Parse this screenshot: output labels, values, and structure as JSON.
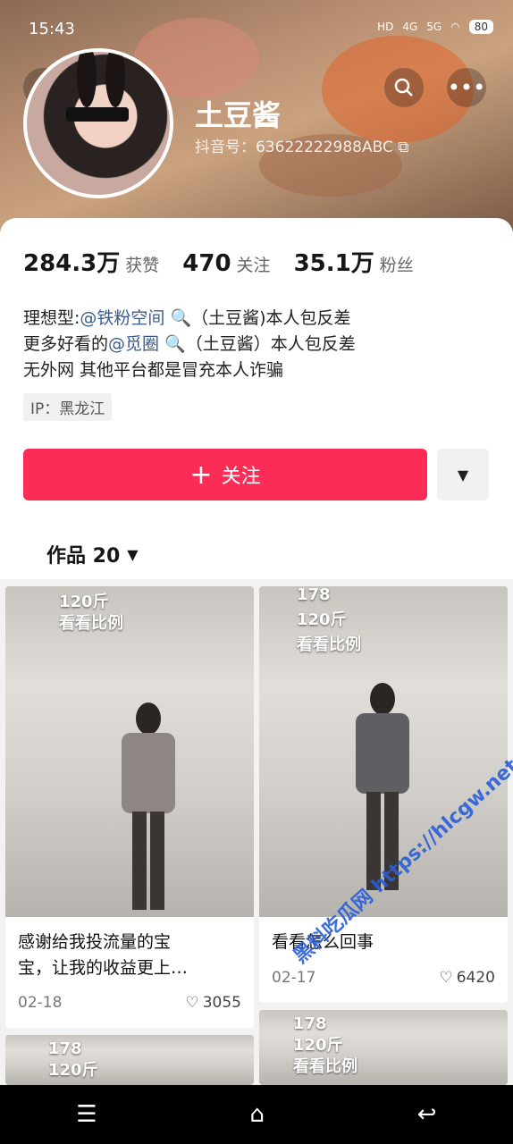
{
  "status_bar": {
    "time": "15:43",
    "hd": "HD",
    "signal_4g": "4G",
    "signal_5g": "5G",
    "battery": "80"
  },
  "profile": {
    "name": "土豆酱",
    "handle": "抖音号：63622222988ABC",
    "stats": [
      {
        "num": "284.3万",
        "label": "获赞"
      },
      {
        "num": "470",
        "label": "关注"
      },
      {
        "num": "35.1万",
        "label": "粉丝"
      }
    ],
    "bio": {
      "line1_prefix": "理想型:",
      "line1_mention": "@铁粉空间",
      "line1_suffix": "（土豆酱)本人包反差",
      "line2_prefix": "更多好看的",
      "line2_mention": "@觅圈",
      "line2_suffix": "（土豆酱）本人包反差",
      "line3": "无外网  其他平台都是冒充本人诈骗"
    },
    "ip": "IP：黑龙江",
    "follow_label": "关注",
    "follow_plus": "+"
  },
  "tabs": {
    "works_label": "作品 20"
  },
  "videos": [
    {
      "overlay1": "120斤",
      "overlay2": "看看比例",
      "title_line1": "感谢给我投流量的宝",
      "title_line2": "宝，让我的收益更上…",
      "date": "02-18",
      "likes": "3055"
    },
    {
      "overlay0": "178",
      "overlay1": "120斤",
      "overlay2": "看看比例",
      "title_line1": "看看怎么回事",
      "date": "02-17",
      "likes": "6420"
    },
    {
      "overlay0": "178",
      "overlay1": "120斤"
    },
    {
      "overlay0": "178",
      "overlay1": "120斤",
      "overlay2": "看看比例"
    }
  ],
  "watermark": "黑料吃瓜网  https://hlcgw.net  看完整版:",
  "colors": {
    "accent": "#fb2c55",
    "mention": "#3a5a8c"
  },
  "icons": [
    "back-icon",
    "search-icon",
    "more-icon",
    "copy-icon",
    "search-small-icon",
    "dropdown-icon",
    "heart-icon",
    "menu-icon",
    "home-icon",
    "back-nav-icon"
  ]
}
